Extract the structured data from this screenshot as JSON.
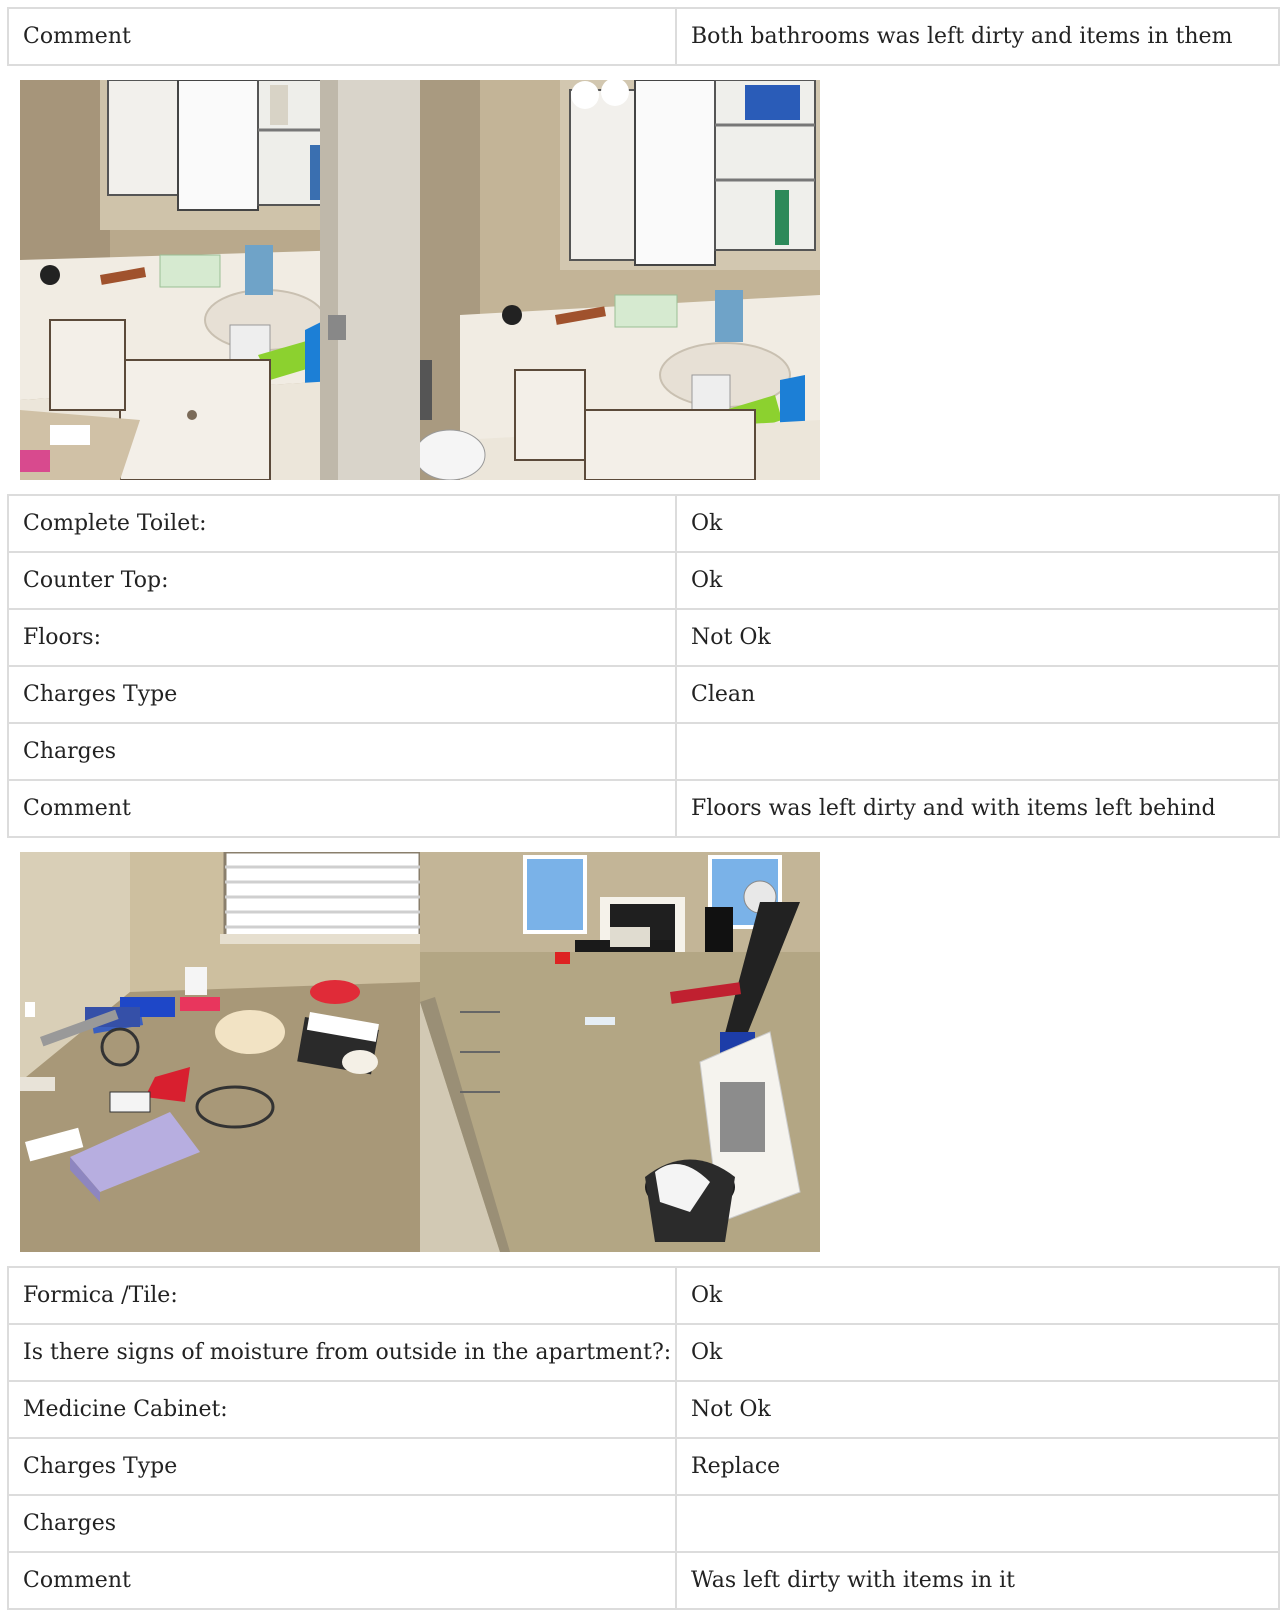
{
  "sections": [
    {
      "rows": [
        {
          "label": "Comment",
          "value": "Both bathrooms was left dirty and items in them"
        }
      ]
    },
    {
      "rows": [
        {
          "label": "Complete Toilet:",
          "value": "Ok"
        },
        {
          "label": "Counter Top:",
          "value": "Ok"
        },
        {
          "label": "Floors:",
          "value": "Not Ok"
        },
        {
          "label": "Charges Type",
          "value": "Clean"
        },
        {
          "label": "Charges",
          "value": ""
        },
        {
          "label": "Comment",
          "value": "Floors was left dirty and with items left behind"
        }
      ]
    },
    {
      "rows": [
        {
          "label": "Formica /Tile:",
          "value": "Ok"
        },
        {
          "label": "Is there signs of moisture from outside in the apartment?:",
          "value": "Ok"
        },
        {
          "label": "Medicine Cabinet:",
          "value": "Not Ok"
        },
        {
          "label": "Charges Type",
          "value": "Replace"
        },
        {
          "label": "Charges",
          "value": ""
        },
        {
          "label": "Comment",
          "value": "Was left dirty with items in it"
        }
      ]
    }
  ]
}
